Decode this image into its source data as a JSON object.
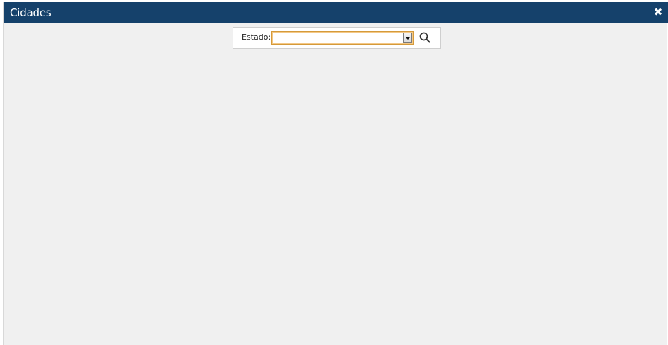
{
  "window": {
    "title": "Cidades",
    "close_glyph": "✖"
  },
  "filter": {
    "label": "Estado:",
    "selected_value": ""
  },
  "icons": {
    "close": "close-icon",
    "search": "search-icon",
    "dropdown": "chevron-down-icon"
  },
  "colors": {
    "titlebar": "#15416b",
    "content_background": "#f0f0f0",
    "select_focus_border": "#d59a3a"
  }
}
